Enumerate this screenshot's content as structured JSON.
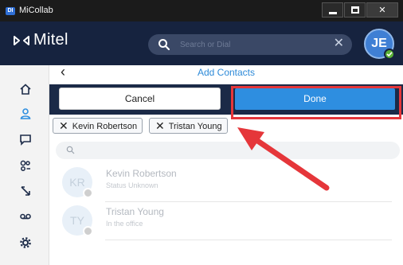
{
  "window": {
    "title": "MiCollab",
    "app_icon_text": "DI"
  },
  "header": {
    "brand": "Mitel",
    "search_placeholder": "Search or Dial",
    "avatar_initials": "JE",
    "presence": "available"
  },
  "page": {
    "title": "Add Contacts",
    "cancel_label": "Cancel",
    "done_label": "Done"
  },
  "selected_contacts": [
    {
      "label": "Kevin Robertson"
    },
    {
      "label": "Tristan Young"
    }
  ],
  "contacts": [
    {
      "initials": "KR",
      "name": "Kevin Robertson",
      "status": "Status Unknown"
    },
    {
      "initials": "TY",
      "name": "Tristan Young",
      "status": "In the office"
    }
  ],
  "colors": {
    "header_bg": "#16233f",
    "action_bar_bg": "#1b2a47",
    "accent": "#2e8ee0",
    "highlight": "#e5363a"
  }
}
